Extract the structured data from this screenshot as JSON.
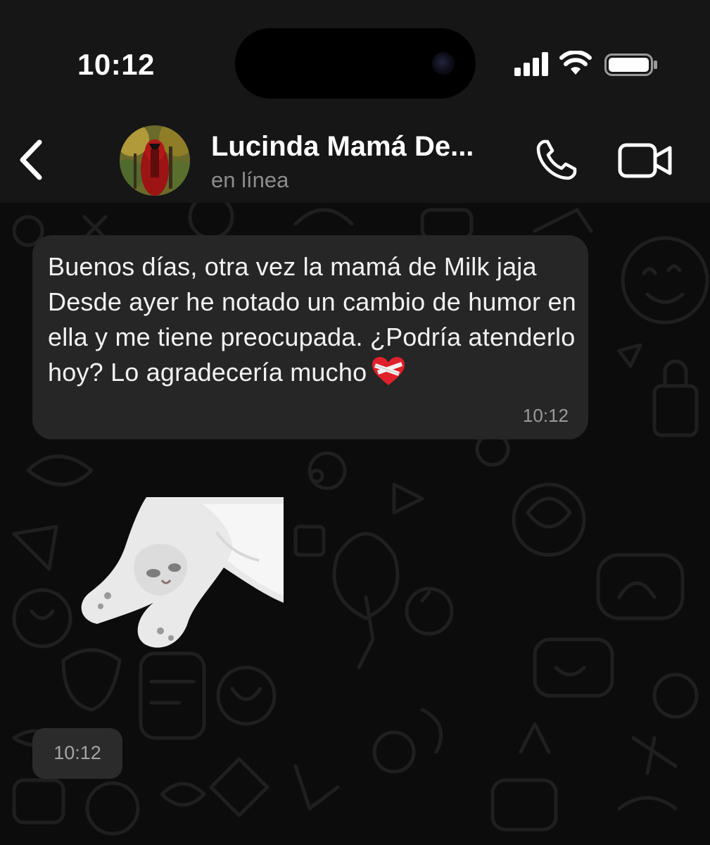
{
  "status_bar": {
    "time": "10:12",
    "icons": [
      "signal-icon",
      "wifi-icon",
      "battery-icon"
    ]
  },
  "header": {
    "back_icon": "chevron-left-icon",
    "contact_name": "Lucinda Mamá De...",
    "contact_status": "en línea",
    "call_icon": "phone-icon",
    "video_icon": "video-camera-icon"
  },
  "messages": [
    {
      "type": "text",
      "direction": "incoming",
      "text": "Buenos días, otra vez la mamá de Milk jaja Desde ayer he notado un cambio de humor en ella y me tiene preocupada. ¿Podría atenderlo hoy? Lo agradecería mucho",
      "emoji": "mending-heart-emoji",
      "time": "10:12"
    },
    {
      "type": "sticker",
      "direction": "incoming",
      "sticker": "white-cat-sticker",
      "time": "10:12"
    }
  ],
  "colors": {
    "header_bg": "#161616",
    "chat_bg": "#0c0c0c",
    "bubble_bg": "#262626",
    "secondary_text": "#8d8d8d"
  }
}
